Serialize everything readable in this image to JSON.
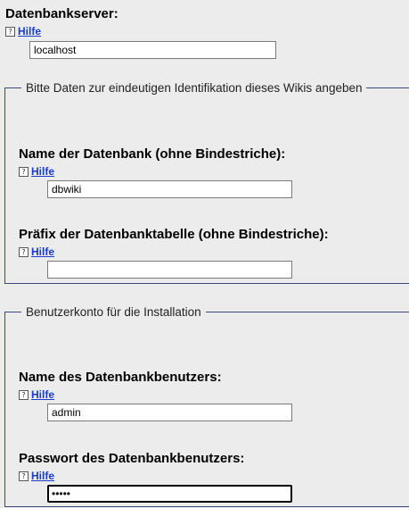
{
  "server": {
    "label": "Datenbankserver:",
    "help": "Hilfe",
    "value": "localhost"
  },
  "identification": {
    "legend": "Bitte Daten zur eindeutigen Identifikation dieses Wikis angeben",
    "db_name": {
      "label": "Name der Datenbank (ohne Bindestriche):",
      "help": "Hilfe",
      "value": "dbwiki"
    },
    "prefix": {
      "label": "Präfix der Datenbanktabelle (ohne Bindestriche):",
      "help": "Hilfe",
      "value": ""
    }
  },
  "account": {
    "legend": "Benutzerkonto für die Installation",
    "user": {
      "label": "Name des Datenbankbenutzers:",
      "help": "Hilfe",
      "value": "admin"
    },
    "password": {
      "label": "Passwort des Datenbankbenutzers:",
      "help": "Hilfe",
      "value": "•••••"
    }
  },
  "icons": {
    "help": "help-icon"
  }
}
